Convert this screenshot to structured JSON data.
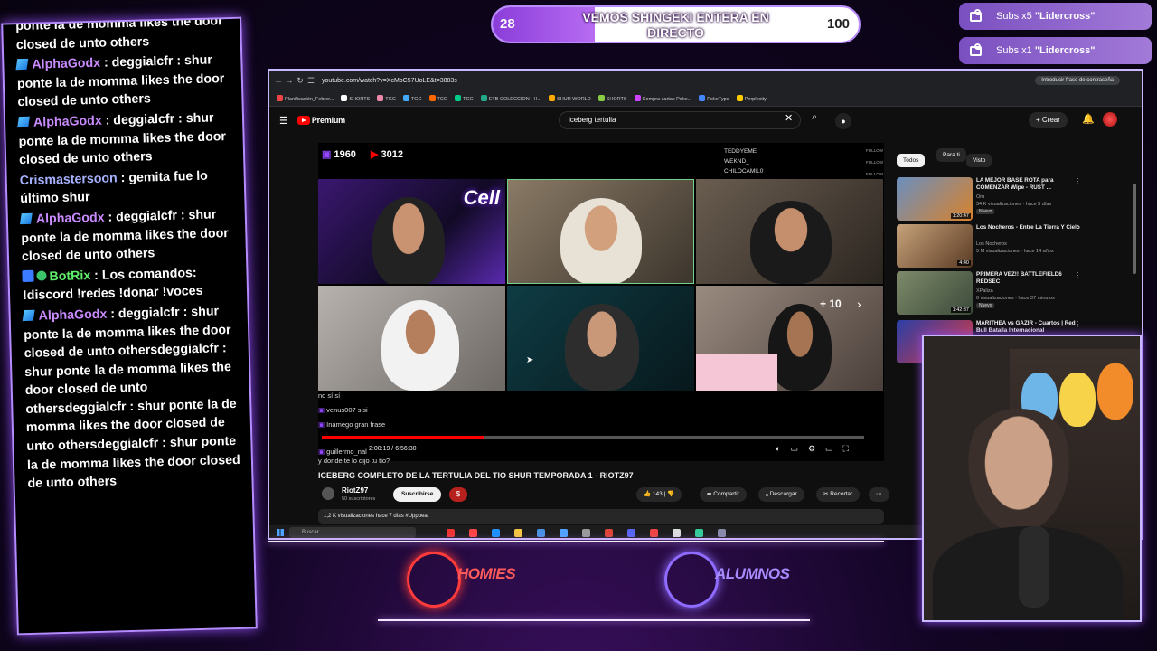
{
  "goal": {
    "current": "28",
    "max": "100",
    "progress": 0.28,
    "title": "VEMOS SHINGEKI ENTERA EN DIRECTO"
  },
  "alerts": [
    {
      "prefix": "Subs x5 ",
      "name": "\"Lidercross\""
    },
    {
      "prefix": "Subs x1 ",
      "name": "\"Lidercross\""
    }
  ],
  "chat": {
    "messages": [
      {
        "badge": "",
        "user": "",
        "text": "ponte la de momma likes the door closed de unto others"
      },
      {
        "badge": "gem",
        "user": "AlphaGodx",
        "text": " : deggialcfr : shur ponte la de momma likes the door closed de unto others"
      },
      {
        "badge": "gem",
        "user": "AlphaGodx",
        "text": " : deggialcfr : shur ponte la de momma likes the door closed de unto others"
      },
      {
        "badge": "",
        "user": "Crismastersoon",
        "text": " : gemita fue lo último shur"
      },
      {
        "badge": "gem",
        "user": "AlphaGodx",
        "text": " : deggialcfr : shur ponte la de momma likes the door closed de unto others"
      },
      {
        "badge": "bot",
        "user": "BotRix",
        "text": " : Los comandos: !discord !redes !donar !voces"
      },
      {
        "badge": "gem",
        "user": "AlphaGodx",
        "text": " : deggialcfr : shur ponte la de momma likes the door closed de unto othersdeggialcfr : shur ponte la de momma likes the door closed de unto othersdeggialcfr : shur ponte la de momma likes the door closed de unto othersdeggialcfr : shur ponte la de momma likes the door closed de unto others"
      }
    ]
  },
  "browser": {
    "url": "youtube.com/watch?v=XcMbC57UoLE&t=3883s",
    "phrase_btn": "Introducir frase de contraseña",
    "bookmarks": [
      "Planificación_Febrer...",
      "SHORTS",
      "TGC",
      "TGC",
      "TCG",
      "TCG",
      "ETB COLECCION - H...",
      "SHUR WORLD",
      "SHORTS",
      "Compra cartas Poke...",
      "PokeType",
      "Perplexity"
    ],
    "bookmark_colors": [
      "#e44",
      "#fff",
      "#e8a",
      "#4af",
      "#f60",
      "#0c8",
      "#2a8",
      "#fa0",
      "#8c4",
      "#c4f",
      "#48f",
      "#fc0"
    ]
  },
  "youtube": {
    "logo": "Premium",
    "search": "iceberg tertulia",
    "create": "+ Crear",
    "video": {
      "stat_a": "1960",
      "stat_b": "3012",
      "streamers": [
        "TEDDYEME",
        "WEKND_",
        "CHILOCAMIL0"
      ],
      "follow": "FOLLOW",
      "cell_tag": "Cell",
      "plus": "+ 10",
      "chat": [
        {
          "user": "venus007",
          "text": "sisi"
        },
        {
          "user": "Inamego",
          "text": "gran frase"
        },
        {
          "user": "guillermo_nal",
          "text": ""
        },
        {
          "user": "",
          "text": "y donde te lo dijo tu tio?"
        },
        {
          "user": "",
          "text": "no sí sí"
        }
      ],
      "time": "2:00:19 / 6:56:30",
      "progress": 0.3
    },
    "title": "ICEBERG COMPLETO DE LA TERTULIA DEL TIO SHUR TEMPORADA 1 - RIOTZ97",
    "channel": "RiotZ97",
    "channel_subs": "50 suscriptores",
    "subscribe": "Suscribirse",
    "likes": "143",
    "share": "Compartir",
    "download": "Descargar",
    "clip": "Recortar",
    "description": "1,2 K visualizaciones  hace 7 días  #Uppbeat",
    "chips": [
      "Todos",
      "Para ti",
      "Visto"
    ],
    "recommendations": [
      {
        "title": "LA MEJOR BASE ROTA para COMENZAR Wipe - RUST ...",
        "channel": "Oru",
        "meta": "34 K visualizaciones · hace 5 días",
        "badge": "Nuevo",
        "duration": "1:20:47"
      },
      {
        "title": "Los Nocheros - Entre La Tierra Y Cielo",
        "channel": "Los Nocheros",
        "meta": "5 M visualizaciones · hace 14 años",
        "badge": "",
        "duration": "4:40"
      },
      {
        "title": "PRIMERA VEZ!! BATTLEFIELD6 REDSEC",
        "channel": "XPaliza",
        "meta": "0 visualizaciones · hace 37 minutos",
        "badge": "Nuevo",
        "duration": "1:42:37"
      },
      {
        "title": "MARITHEA vs GAZIR - Cuartos | Red Bull Batalla Internacional",
        "channel": "",
        "meta": "",
        "badge": "",
        "duration": ""
      }
    ]
  },
  "taskbar": {
    "search": "Buscar"
  },
  "overlay": {
    "logo_left": "HOMIES",
    "logo_right": "ALUMNOS",
    "logo_left_color": "#ff3b3b",
    "logo_right_color": "#8f6bff"
  }
}
